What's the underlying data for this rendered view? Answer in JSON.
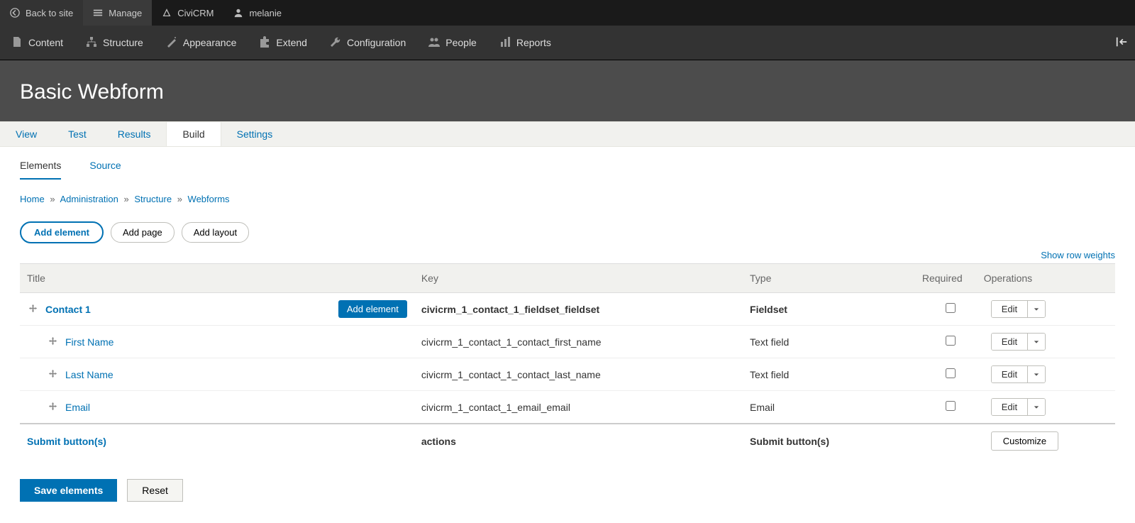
{
  "topbar": {
    "back": "Back to site",
    "manage": "Manage",
    "civi": "CiviCRM",
    "user": "melanie"
  },
  "toolbar": {
    "content": "Content",
    "structure": "Structure",
    "appearance": "Appearance",
    "extend": "Extend",
    "configuration": "Configuration",
    "people": "People",
    "reports": "Reports"
  },
  "page_title": "Basic Webform",
  "ptabs": {
    "view": "View",
    "test": "Test",
    "results": "Results",
    "build": "Build",
    "settings": "Settings"
  },
  "stabs": {
    "elements": "Elements",
    "source": "Source"
  },
  "breadcrumb": {
    "home": "Home",
    "admin": "Administration",
    "structure": "Structure",
    "webforms": "Webforms"
  },
  "action_buttons": {
    "add_element": "Add element",
    "add_page": "Add page",
    "add_layout": "Add layout"
  },
  "show_weights": "Show row weights",
  "columns": {
    "title": "Title",
    "key": "Key",
    "type": "Type",
    "required": "Required",
    "operations": "Operations"
  },
  "rows": [
    {
      "indent": 0,
      "title": "Contact 1",
      "title_bold": true,
      "add_element_btn": "Add element",
      "key": "civicrm_1_contact_1_fieldset_fieldset",
      "key_bold": true,
      "type": "Fieldset",
      "type_bold": true,
      "required_checkbox": true,
      "op": "edit"
    },
    {
      "indent": 1,
      "title": "First Name",
      "key": "civicrm_1_contact_1_contact_first_name",
      "type": "Text field",
      "required_checkbox": true,
      "op": "edit"
    },
    {
      "indent": 1,
      "title": "Last Name",
      "key": "civicrm_1_contact_1_contact_last_name",
      "type": "Text field",
      "required_checkbox": true,
      "op": "edit"
    },
    {
      "indent": 1,
      "title": "Email",
      "key": "civicrm_1_contact_1_email_email",
      "type": "Email",
      "required_checkbox": true,
      "op": "edit"
    },
    {
      "indent": 0,
      "title": "Submit button(s)",
      "title_bold": true,
      "no_handle": true,
      "key": "actions",
      "key_bold": true,
      "type": "Submit button(s)",
      "type_bold": true,
      "required_checkbox": false,
      "op": "customize"
    }
  ],
  "ops_labels": {
    "edit": "Edit",
    "customize": "Customize"
  },
  "footer": {
    "save": "Save elements",
    "reset": "Reset"
  }
}
